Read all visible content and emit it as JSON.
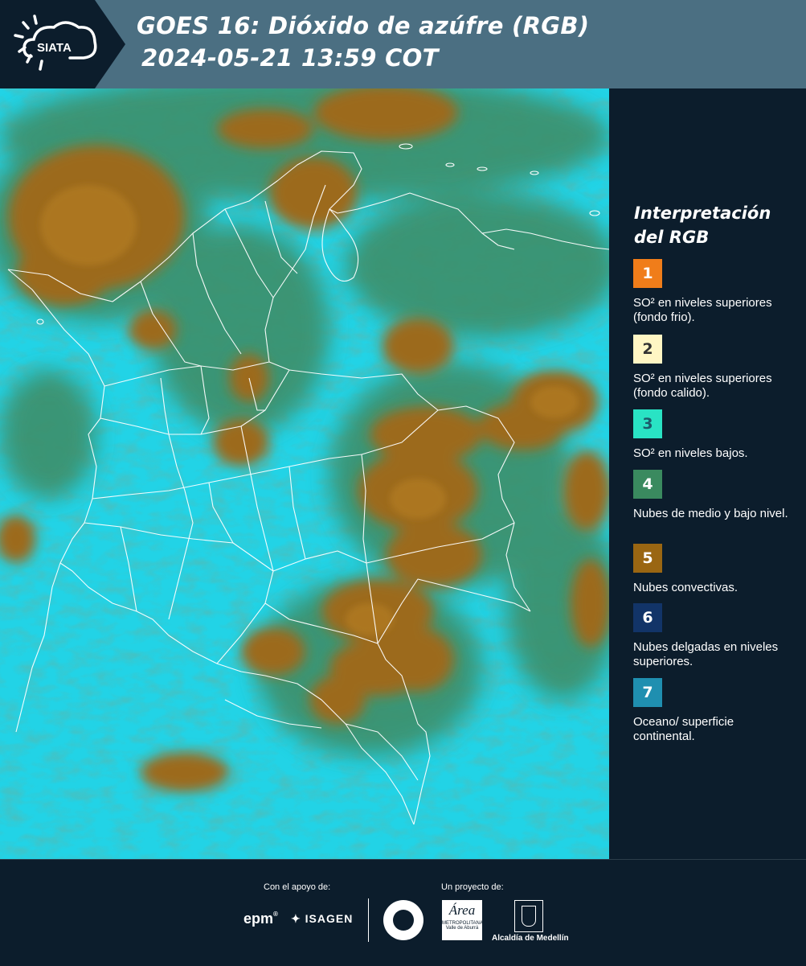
{
  "header": {
    "logo_text": "SIATA",
    "title_line_1": "GOES 16: Dióxido de azúfre (RGB)",
    "title_line_2": "2024-05-21 13:59 COT"
  },
  "legend": {
    "title": "Interpretación del RGB",
    "items": [
      {
        "number": "1",
        "color": "#f07d1a",
        "label": "SO² en niveles superiores (fondo frio)."
      },
      {
        "number": "2",
        "color": "#fff6c4",
        "label": "SO² en niveles superiores (fondo calido)."
      },
      {
        "number": "3",
        "color": "#29e3c4",
        "label": "SO² en niveles bajos."
      },
      {
        "number": "4",
        "color": "#3a8a5f",
        "label": "Nubes de medio y bajo nivel."
      },
      {
        "number": "5",
        "color": "#9a6612",
        "label": "Nubes convectivas."
      },
      {
        "number": "6",
        "color": "#123468",
        "label": "Nubes delgadas en niveles superiores."
      },
      {
        "number": "7",
        "color": "#1f8fb0",
        "label": "Oceano/ superficie continental."
      }
    ]
  },
  "footer": {
    "support_label": "Con el apoyo de:",
    "project_label": "Un proyecto de:",
    "sponsor_epm": "epm",
    "sponsor_isagen": "ISAGEN",
    "area_logo_text": "Área",
    "area_logo_sub": "METROPOLITANA",
    "area_logo_sub2": "Valle de Aburrá",
    "alcaldia_text": "Alcaldía de Medellín"
  },
  "colors": {
    "background": "#0c1d2c",
    "header_band": "#4b6f82",
    "map_cyan": "#22d3e6",
    "cloud_brown": "#9c6a1c",
    "cloud_green": "#3d8f6a"
  }
}
